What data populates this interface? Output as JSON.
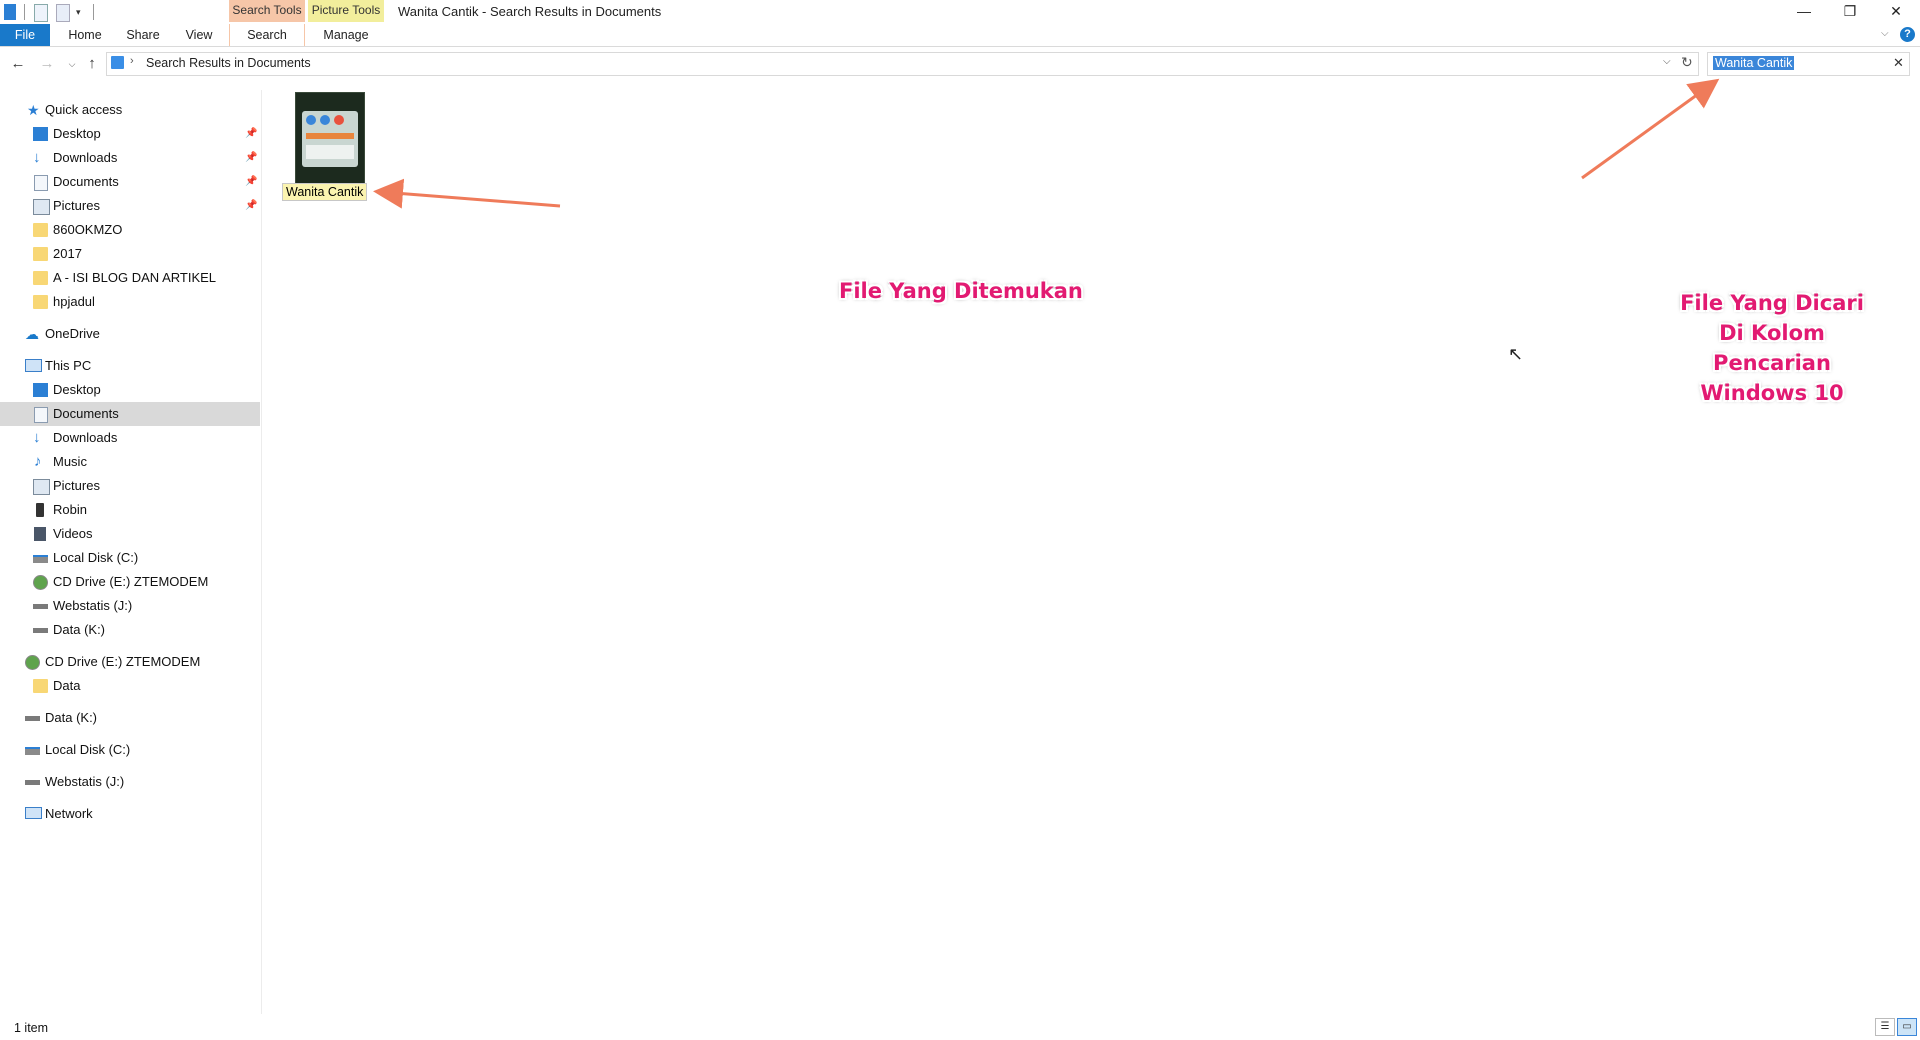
{
  "window": {
    "title": "Wanita Cantik - Search Results in Documents",
    "contextual_tabs": [
      "Search Tools",
      "Picture Tools"
    ],
    "controls": {
      "minimize": "—",
      "restore": "❐",
      "close": "✕"
    }
  },
  "ribbon": {
    "tabs": [
      "File",
      "Home",
      "Share",
      "View",
      "Search",
      "Manage"
    ],
    "active_tab": "Search"
  },
  "navigation": {
    "breadcrumb": "Search Results in Documents",
    "search_value": "Wanita Cantik"
  },
  "sidebar": {
    "quick_access": {
      "label": "Quick access",
      "items": [
        {
          "label": "Desktop",
          "pinned": true
        },
        {
          "label": "Downloads",
          "pinned": true
        },
        {
          "label": "Documents",
          "pinned": true
        },
        {
          "label": "Pictures",
          "pinned": true
        },
        {
          "label": "860OKMZO",
          "pinned": false
        },
        {
          "label": "2017",
          "pinned": false
        },
        {
          "label": "A - ISI BLOG DAN ARTIKEL",
          "pinned": false
        },
        {
          "label": "hpjadul",
          "pinned": false
        }
      ]
    },
    "onedrive": "OneDrive",
    "this_pc": {
      "label": "This PC",
      "items": [
        "Desktop",
        "Documents",
        "Downloads",
        "Music",
        "Pictures",
        "Robin",
        "Videos",
        "Local Disk (C:)",
        "CD Drive (E:) ZTEMODEM",
        "Webstatis (J:)",
        "Data (K:)"
      ],
      "selected": "Documents"
    },
    "cd_drive": {
      "label": "CD Drive (E:) ZTEMODEM",
      "items": [
        "Data"
      ]
    },
    "drives": [
      "Data (K:)",
      "Local Disk (C:)",
      "Webstatis (J:)"
    ],
    "network": "Network"
  },
  "content": {
    "file": {
      "name": "Wanita Cantik"
    },
    "annotations": {
      "found": "File Yang Ditemukan",
      "searched": [
        "File Yang Dicari",
        "Di Kolom",
        "Pencarian",
        "Windows 10"
      ]
    }
  },
  "status": {
    "text": "1 item"
  },
  "colors": {
    "accent": "#1979ca",
    "annotation": "#e21a72",
    "arrow": "#ef7b5a",
    "selection": "#d9d9d9"
  }
}
